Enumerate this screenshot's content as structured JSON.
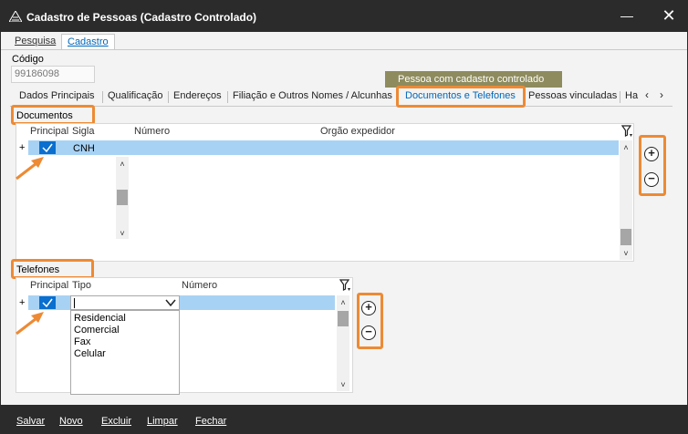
{
  "window": {
    "title": "Cadastro de Pessoas (Cadastro Controlado)",
    "minimize_label": "—",
    "close_label": "✕"
  },
  "top_tabs": [
    {
      "label": "Pesquisa",
      "active": false
    },
    {
      "label": "Cadastro",
      "active": true
    }
  ],
  "codigo": {
    "label": "Código",
    "value": "99186098"
  },
  "banner": "Pessoa com cadastro controlado",
  "sub_tabs": [
    {
      "label": "Dados Principais"
    },
    {
      "label": "Qualificação"
    },
    {
      "label": "Endereços"
    },
    {
      "label": "Filiação e Outros Nomes / Alcunhas"
    },
    {
      "label": "Documentos e Telefones",
      "active": true
    },
    {
      "label": "Pessoas vinculadas"
    },
    {
      "label": "Ha"
    }
  ],
  "nav": {
    "prev": "‹",
    "next": "›"
  },
  "documentos": {
    "section_label": "Documentos",
    "columns": [
      "Principal",
      "Sigla",
      "Número",
      "Orgão expedidor"
    ],
    "rows": [
      {
        "principal": true,
        "sigla": "CNH",
        "numero": "",
        "orgao": ""
      }
    ],
    "row_marker": "+"
  },
  "telefones": {
    "section_label": "Telefones",
    "columns": [
      "Principal",
      "Tipo",
      "Número"
    ],
    "rows": [
      {
        "principal": true,
        "tipo": "",
        "numero": ""
      }
    ],
    "row_marker": "+",
    "tipo_options": [
      "Residencial",
      "Comercial",
      "Fax",
      "Celular"
    ]
  },
  "buttons": {
    "add": "+",
    "remove": "−"
  },
  "footer": [
    "Salvar",
    "Novo",
    "Excluir",
    "Limpar",
    "Fechar"
  ],
  "colors": {
    "titlebar": "#2b2b2b",
    "accent": "#0067b8",
    "highlight_box": "#ed8a34",
    "selected_row": "#a8d2f4",
    "banner": "#8e8b5e"
  }
}
